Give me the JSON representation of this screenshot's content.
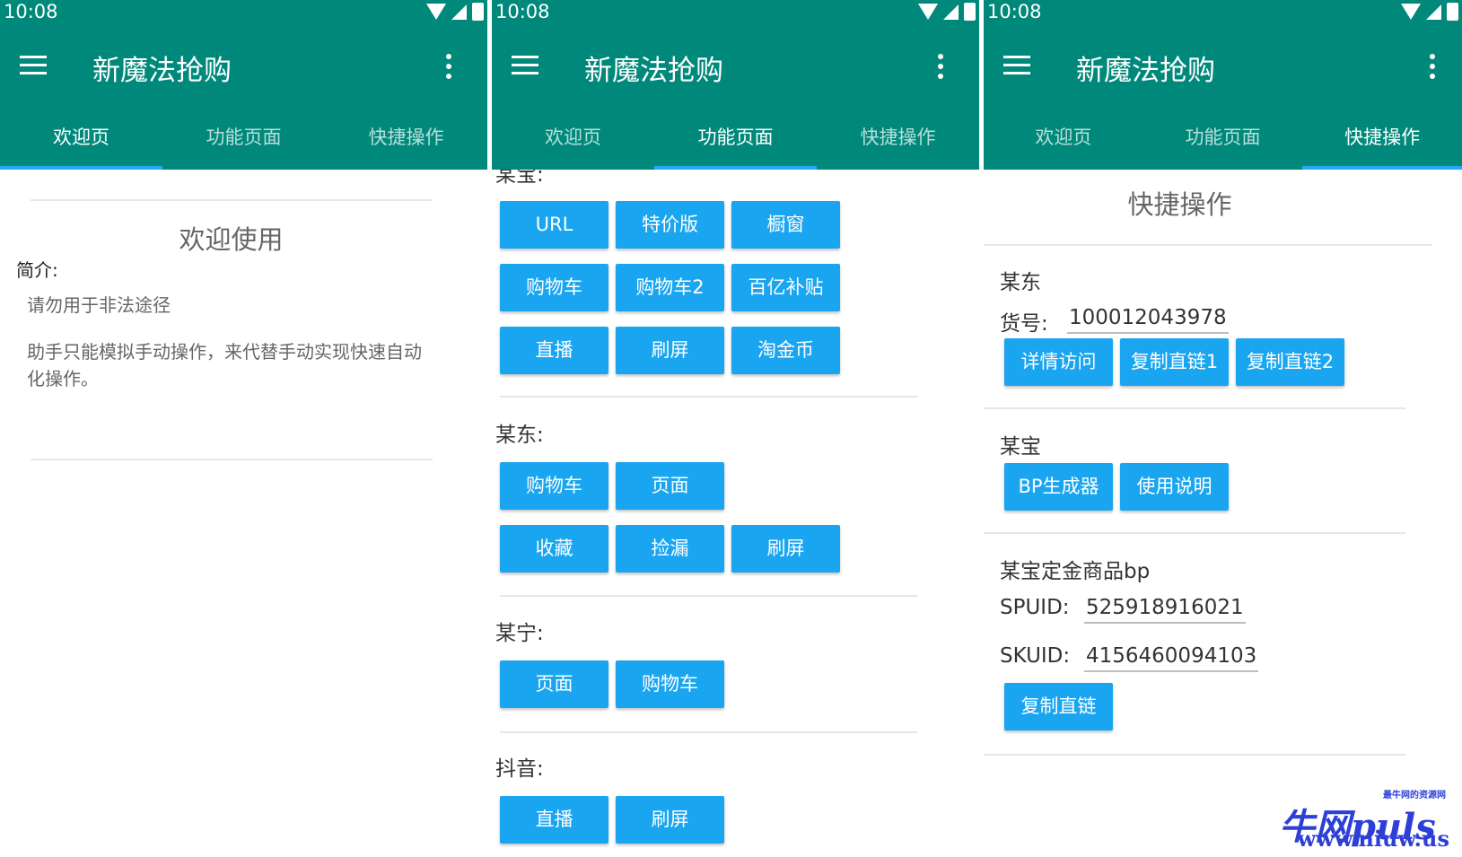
{
  "status": {
    "time": "10:08"
  },
  "app": {
    "title": "新魔法抢购"
  },
  "tabs": [
    "欢迎页",
    "功能页面",
    "快捷操作"
  ],
  "welcome": {
    "heading": "欢迎使用",
    "intro_label": "简介:",
    "line1": "请勿用于非法途径",
    "line2a": "助手只能模拟手动操作，来代替手动实现快速自动",
    "line2b": "化操作。"
  },
  "features": {
    "top_partial_label": "某宝:",
    "mou_bao_buttons": [
      "URL",
      "特价版",
      "橱窗",
      "购物车",
      "购物车2",
      "百亿补贴",
      "直播",
      "刷屏",
      "淘金币"
    ],
    "mou_dong_label": "某东:",
    "mou_dong_buttons": [
      "购物车",
      "页面",
      "收藏",
      "捡漏",
      "刷屏"
    ],
    "mou_ning_label": "某宁:",
    "mou_ning_buttons": [
      "页面",
      "购物车"
    ],
    "douyin_label": "抖音:",
    "douyin_buttons": [
      "直播",
      "刷屏"
    ]
  },
  "quick": {
    "heading": "快捷操作",
    "mou_dong": {
      "label": "某东",
      "item_label": "货号:",
      "item_value": "100012043978",
      "buttons": [
        "详情访问",
        "复制直链1",
        "复制直链2"
      ]
    },
    "mou_bao": {
      "label": "某宝",
      "buttons": [
        "BP生成器",
        "使用说明"
      ]
    },
    "deposit": {
      "label": "某宝定金商品bp",
      "spuid_label": "SPUID:",
      "spuid_value": "525918916021",
      "skuid_label": "SKUID:",
      "skuid_value": "4156460094103",
      "button": "复制直链"
    }
  },
  "watermark": {
    "brand": "牛网puls",
    "tagline": "最牛网的资源网",
    "url": "www.niuw.us"
  },
  "colors": {
    "app_bar": "#00897b",
    "button": "#1aa5f0",
    "tab_indicator": "#26a9f5"
  },
  "icons": [
    "menu-icon",
    "more-vert-icon",
    "wifi-icon",
    "signal-icon",
    "battery-icon"
  ]
}
